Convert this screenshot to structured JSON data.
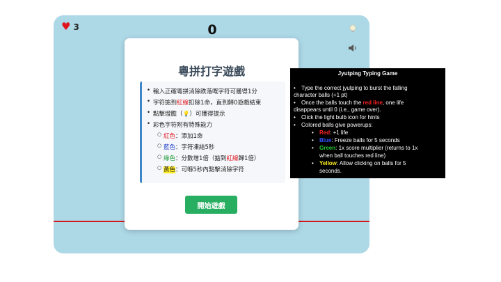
{
  "hud": {
    "lives": "3",
    "score": "0",
    "icons": {
      "lives": "heart-icon",
      "hint": "light-bulb-icon",
      "sound": "speaker-icon"
    }
  },
  "colors": {
    "game_bg": "#add8e6",
    "red_line": "#d61a1a",
    "start_button": "#27ae60",
    "rules_border": "#3e86c8"
  },
  "card": {
    "title": "粵拼打字遊戲",
    "rules": [
      "輸入正確粵拼消除跌落嘅字符可獲得1分",
      "字符掂到",
      "紅線",
      "扣除1命，直到歸0遊戲結束",
      "點擊燈膽（",
      "）可獲得提示",
      "彩色字符附有特殊能力"
    ],
    "powerups": {
      "red_label": "紅色",
      "red_desc": "：添加1命",
      "blue_label": "藍色",
      "blue_desc": "：字符凍結5秒",
      "green_label": "綠色",
      "green_desc": "：分數增1倍（掂到",
      "green_red_line": "紅線",
      "green_end": "歸1倍）",
      "yellow_label": "黃色",
      "yellow_desc": "：可喺5秒內點擊消除字符"
    },
    "start_button": "開始遊戲"
  },
  "tooltip": {
    "title": "Jyutping Typing Game",
    "items": [
      "Type the correct jyutping to burst the falling",
      "character balls (+1 pt)",
      "Once the balls touch the ",
      "red line",
      ", one life",
      "disappears until 0 (i.e., game over).",
      "Click the light bulb icon for hints",
      "Colored balls give powerups:"
    ],
    "powerups": {
      "red_label": "Red",
      "red_desc": ": +1 life",
      "blue_label": "Blue",
      "blue_desc": ": Freeze balls for 5 seconds",
      "green_label": "Green",
      "green_desc": ": 1x score multiplier (returns to 1x",
      "green_cont": "when ball touches red line)",
      "yellow_label": "Yellow",
      "yellow_desc": ": Allow clicking on balls for 5",
      "yellow_cont": "seconds."
    }
  }
}
